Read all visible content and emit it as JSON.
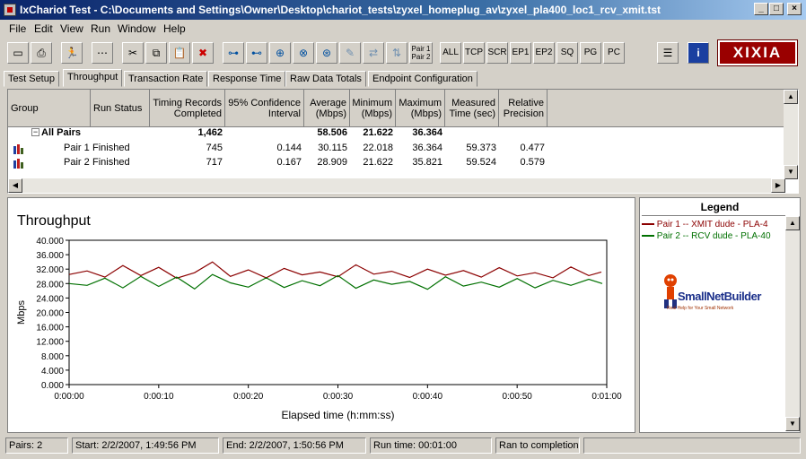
{
  "window": {
    "title": "IxChariot Test - C:\\Documents and Settings\\Owner\\Desktop\\chariot_tests\\zyxel_homeplug_av\\zyxel_pla400_loc1_rcv_xmit.tst",
    "minimize": "_",
    "maximize": "□",
    "close": "×"
  },
  "menu": [
    "File",
    "Edit",
    "View",
    "Run",
    "Window",
    "Help"
  ],
  "toolbar": {
    "pair_label_line1": "Pair 1",
    "pair_label_line2": "Pair 2",
    "filters": [
      "ALL",
      "TCP",
      "SCR",
      "EP1",
      "EP2",
      "SQ",
      "PG",
      "PC"
    ],
    "brand": "XIXIA"
  },
  "tabs": [
    "Test Setup",
    "Throughput",
    "Transaction Rate",
    "Response Time",
    "Raw Data Totals",
    "Endpoint Configuration"
  ],
  "active_tab": "Throughput",
  "grid": {
    "headers": {
      "group": "Group",
      "run_status": "Run Status",
      "timing_line1": "Timing Records",
      "timing_line2": "Completed",
      "conf_line1": "95% Confidence",
      "conf_line2": "Interval",
      "avg_line1": "Average",
      "avg_line2": "(Mbps)",
      "min_line1": "Minimum",
      "min_line2": "(Mbps)",
      "max_line1": "Maximum",
      "max_line2": "(Mbps)",
      "meas_line1": "Measured",
      "meas_line2": "Time (sec)",
      "rel_line1": "Relative",
      "rel_line2": "Precision"
    },
    "all_pairs": {
      "expander": "−",
      "label": "All Pairs",
      "timing": "1,462",
      "average": "58.506",
      "minimum": "21.622",
      "maximum": "36.364"
    },
    "rows": [
      {
        "group": "Pair 1",
        "status": "Finished",
        "timing": "745",
        "confidence": "0.144",
        "average": "30.115",
        "minimum": "22.018",
        "maximum": "36.364",
        "measured": "59.373",
        "precision": "0.477"
      },
      {
        "group": "Pair 2",
        "status": "Finished",
        "timing": "717",
        "confidence": "0.167",
        "average": "28.909",
        "minimum": "21.622",
        "maximum": "35.821",
        "measured": "59.524",
        "precision": "0.579"
      }
    ]
  },
  "legend": {
    "title": "Legend",
    "entries": [
      {
        "label": "Pair 1 -- XMIT dude - PLA-4",
        "color": "#8b0000"
      },
      {
        "label": "Pair 2 -- RCV dude - PLA-40",
        "color": "#007000"
      }
    ],
    "logo_text": "SmallNetBuilder",
    "logo_tagline": "Real Help for Your Small Network"
  },
  "chart_data": {
    "type": "line",
    "title": "Throughput",
    "xlabel": "Elapsed time (h:mm:ss)",
    "ylabel": "Mbps",
    "ylim": [
      0,
      40
    ],
    "xlim": [
      0,
      60
    ],
    "y_ticks": [
      "0.000",
      "4.000",
      "8.000",
      "12.000",
      "16.000",
      "20.000",
      "24.000",
      "28.000",
      "32.000",
      "36.000",
      "40.000"
    ],
    "x_ticks": [
      "0:00:00",
      "0:00:10",
      "0:00:20",
      "0:00:30",
      "0:00:40",
      "0:00:50",
      "0:01:00"
    ],
    "grid": false,
    "series": [
      {
        "name": "Pair 1 -- XMIT dude - PLA-4",
        "color": "#8b0000",
        "x": [
          0,
          2,
          4,
          6,
          8,
          10,
          12,
          14,
          16,
          18,
          20,
          22,
          24,
          26,
          28,
          30,
          32,
          34,
          36,
          38,
          40,
          42,
          44,
          46,
          48,
          50,
          52,
          54,
          56,
          58,
          59.4
        ],
        "y": [
          30.5,
          31.5,
          29.8,
          33.0,
          30.2,
          32.5,
          29.5,
          31.0,
          34.0,
          30.0,
          31.8,
          29.6,
          32.2,
          30.4,
          31.2,
          29.9,
          33.2,
          30.6,
          31.4,
          29.7,
          32.0,
          30.3,
          31.6,
          29.8,
          32.4,
          30.1,
          31.0,
          29.6,
          32.6,
          30.2,
          31.2
        ]
      },
      {
        "name": "Pair 2 -- RCV dude - PLA-40",
        "color": "#007000",
        "x": [
          0,
          2,
          4,
          6,
          8,
          10,
          12,
          14,
          16,
          18,
          20,
          22,
          24,
          26,
          28,
          30,
          32,
          34,
          36,
          38,
          40,
          42,
          44,
          46,
          48,
          50,
          52,
          54,
          56,
          58,
          59.5
        ],
        "y": [
          28.0,
          27.5,
          29.5,
          26.8,
          30.0,
          27.2,
          29.8,
          26.5,
          30.5,
          28.2,
          27.0,
          29.6,
          26.9,
          28.8,
          27.4,
          30.2,
          26.7,
          29.0,
          27.8,
          28.6,
          26.4,
          29.9,
          27.3,
          28.4,
          27.0,
          29.4,
          26.8,
          28.9,
          27.5,
          29.2,
          28.0
        ]
      }
    ]
  },
  "status": {
    "pairs": "Pairs: 2",
    "start": "Start: 2/2/2007, 1:49:56 PM",
    "end": "End: 2/2/2007, 1:50:56 PM",
    "runtime": "Run time: 00:01:00",
    "state": "Ran to completion"
  }
}
